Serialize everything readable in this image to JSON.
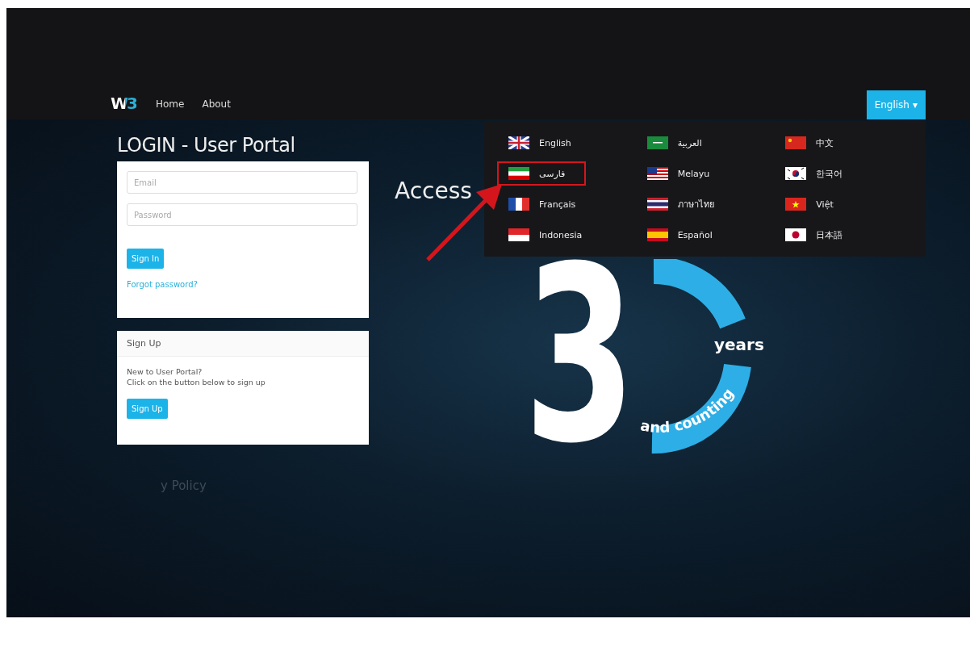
{
  "nav": {
    "logo": "W3",
    "links": [
      "Home",
      "About"
    ],
    "language_button": "English",
    "caret": "▾"
  },
  "login": {
    "title": "LOGIN - User Portal",
    "email": {
      "placeholder": "Email"
    },
    "password": {
      "placeholder": "Password"
    },
    "sign_in": "Sign In",
    "forgot": "Forgot password?"
  },
  "signup": {
    "title": "Sign Up",
    "text": [
      "New to User Portal?",
      "Click on the button below to sign up"
    ],
    "button": "Sign Up"
  },
  "footer_text": "y Policy",
  "access_heading": "Access",
  "promo": {
    "number": "3",
    "years": "years",
    "counting": "and counting"
  },
  "language_menu": {
    "open": true,
    "items": [
      {
        "label": "English",
        "kind": "gb",
        "highlighted": false
      },
      {
        "label": "العربية",
        "kind": "sa",
        "highlighted": false
      },
      {
        "label": "中文",
        "kind": "cn",
        "highlighted": false
      },
      {
        "label": "فارسی",
        "kind": "ir",
        "highlighted": true
      },
      {
        "label": "Melayu",
        "kind": "my",
        "highlighted": false
      },
      {
        "label": "한국어",
        "kind": "kr",
        "highlighted": false
      },
      {
        "label": "Français",
        "kind": "fr",
        "highlighted": false
      },
      {
        "label": "ภาษาไทย",
        "kind": "th",
        "highlighted": false
      },
      {
        "label": "Việt",
        "kind": "vn",
        "highlighted": false
      },
      {
        "label": "Indonesia",
        "kind": "id",
        "highlighted": false
      },
      {
        "label": "Español",
        "kind": "es",
        "highlighted": false
      },
      {
        "label": "日本語",
        "kind": "jp",
        "highlighted": false
      }
    ]
  },
  "annotation_arrow": true
}
